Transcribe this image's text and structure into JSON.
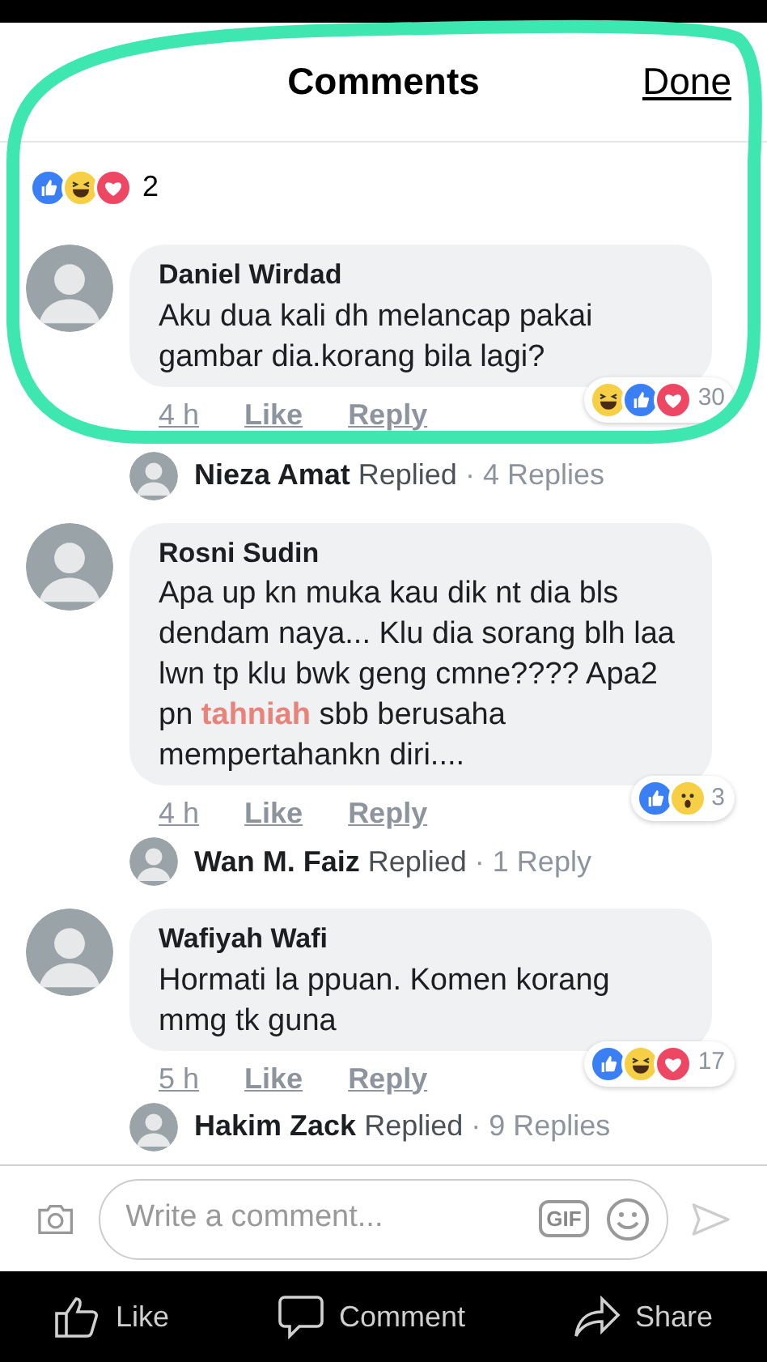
{
  "header": {
    "title": "Comments",
    "done": "Done"
  },
  "post_reactions": {
    "reactions": [
      {
        "kind": "like"
      },
      {
        "kind": "haha"
      },
      {
        "kind": "love"
      }
    ],
    "count": "2"
  },
  "comments": [
    {
      "name": "Daniel Wirdad",
      "segments": [
        {
          "text": "Aku dua kali dh melancap pakai gambar dia.korang bila lagi?",
          "highlight": false
        }
      ],
      "time": "4 h",
      "like": "Like",
      "reply": "Reply",
      "reactions": [
        {
          "kind": "haha"
        },
        {
          "kind": "like"
        },
        {
          "kind": "love"
        }
      ],
      "count": "30",
      "replied": {
        "name": "Nieza Amat",
        "label": "Replied",
        "meta": "· 4 Replies"
      }
    },
    {
      "name": "Rosni Sudin",
      "segments": [
        {
          "text": "Apa up kn muka kau dik nt dia bls dendam naya... Klu dia sorang blh laa lwn tp klu bwk geng cmne???? Apa2 pn ",
          "highlight": false
        },
        {
          "text": "tahniah",
          "highlight": true
        },
        {
          "text": " sbb berusaha mempertahankn diri....",
          "highlight": false
        }
      ],
      "time": "4 h",
      "like": "Like",
      "reply": "Reply",
      "reactions": [
        {
          "kind": "like"
        },
        {
          "kind": "wow"
        }
      ],
      "count": "3",
      "replied": {
        "name": "Wan M. Faiz",
        "label": "Replied",
        "meta": "· 1 Reply"
      }
    },
    {
      "name": "Wafiyah Wafi",
      "segments": [
        {
          "text": "Hormati la ppuan. Komen korang mmg tk guna",
          "highlight": false
        }
      ],
      "time": "5 h",
      "like": "Like",
      "reply": "Reply",
      "reactions": [
        {
          "kind": "like"
        },
        {
          "kind": "haha"
        },
        {
          "kind": "love"
        }
      ],
      "count": "17",
      "replied": {
        "name": "Hakim Zack",
        "label": "Replied",
        "meta": "· 9 Replies"
      }
    }
  ],
  "composer": {
    "placeholder": "Write a comment...",
    "gif": "GIF"
  },
  "actions": [
    {
      "kind": "like",
      "label": "Like"
    },
    {
      "kind": "comment",
      "label": "Comment"
    },
    {
      "kind": "share",
      "label": "Share"
    }
  ]
}
